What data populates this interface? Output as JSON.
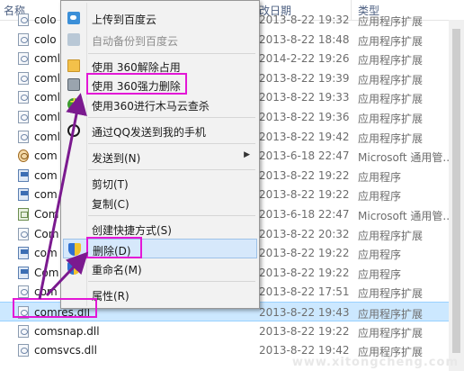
{
  "columns": {
    "name": "名称",
    "date": "改日期",
    "type": "类型"
  },
  "files": [
    {
      "name": "colo",
      "date": "2013-8-22 19:32",
      "type": "应用程序扩展",
      "icon": "dll-icon"
    },
    {
      "name": "colo",
      "date": "2013-8-22 18:48",
      "type": "应用程序扩展",
      "icon": "dll-icon"
    },
    {
      "name": "coml",
      "date": "2014-2-22 19:26",
      "type": "应用程序扩展",
      "icon": "dll-icon"
    },
    {
      "name": "coml",
      "date": "2013-8-22 19:39",
      "type": "应用程序扩展",
      "icon": "dll-icon"
    },
    {
      "name": "coml",
      "date": "2013-8-22 19:33",
      "type": "应用程序扩展",
      "icon": "dll-icon"
    },
    {
      "name": "coml",
      "date": "2013-8-22 19:36",
      "type": "应用程序扩展",
      "icon": "dll-icon"
    },
    {
      "name": "coml",
      "date": "2013-8-22 19:42",
      "type": "应用程序扩展",
      "icon": "dll-icon"
    },
    {
      "name": "com",
      "date": "2013-6-18 22:47",
      "type": "Microsoft 通用管...",
      "icon": "gear-icon"
    },
    {
      "name": "com",
      "date": "2013-8-22 19:22",
      "type": "应用程序",
      "icon": "exe-icon"
    },
    {
      "name": "com",
      "date": "2013-8-22 19:22",
      "type": "应用程序",
      "icon": "exe-icon"
    },
    {
      "name": "Com",
      "date": "2013-6-18 22:47",
      "type": "Microsoft 通用管...",
      "icon": "grid-icon"
    },
    {
      "name": "Com",
      "date": "2013-8-22 20:32",
      "type": "应用程序扩展",
      "icon": "dll-icon"
    },
    {
      "name": "com",
      "date": "2013-8-22 19:22",
      "type": "应用程序",
      "icon": "exe-icon"
    },
    {
      "name": "Com",
      "date": "2013-8-22 19:22",
      "type": "应用程序",
      "icon": "exe-icon"
    },
    {
      "name": "com",
      "date": "2013-8-22 17:51",
      "type": "应用程序扩展",
      "icon": "dll-icon"
    },
    {
      "name": "comres.dll",
      "date": "2013-8-22 19:43",
      "type": "应用程序扩展",
      "icon": "dll-icon",
      "selected": true
    },
    {
      "name": "comsnap.dll",
      "date": "2013-8-22 19:22",
      "type": "应用程序扩展",
      "icon": "dll-icon"
    },
    {
      "name": "comsvcs.dll",
      "date": "2013-8-22 19:42",
      "type": "应用程序扩展",
      "icon": "dll-icon"
    }
  ],
  "menu": {
    "upload_cloud": "上传到百度云",
    "auto_backup": "自动备份到百度云",
    "unlock_360": "使用 360解除占用",
    "force_delete_360": "使用 360强力删除",
    "trojan_scan_360": "使用360进行木马云查杀",
    "send_qq": "通过QQ发送到我的手机",
    "send_to": "发送到(N)",
    "cut": "剪切(T)",
    "copy": "复制(C)",
    "create_shortcut": "创建快捷方式(S)",
    "delete": "删除(D)",
    "rename": "重命名(M)",
    "properties": "属性(R)"
  },
  "colors": {
    "highlight": "#e317d6",
    "arrow": "#7b1a8f",
    "selection": "#cce8ff",
    "menu_hover": "#d6e8fb"
  }
}
